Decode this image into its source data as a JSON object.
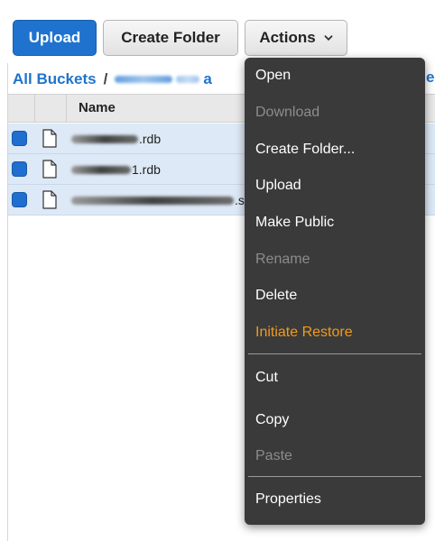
{
  "toolbar": {
    "upload_label": "Upload",
    "create_folder_label": "Create Folder",
    "actions_label": "Actions"
  },
  "breadcrumb": {
    "root": "All Buckets",
    "separator": "/",
    "current_suffix": "a",
    "trailing_fragment": "er"
  },
  "table": {
    "name_header": "Name",
    "files": [
      {
        "name_visible": ".rdb",
        "selected": true
      },
      {
        "name_visible": "1.rdb",
        "selected": true
      },
      {
        "name_visible": ".s",
        "selected": true
      }
    ]
  },
  "actions_menu": {
    "items": [
      {
        "label": "Open",
        "state": "enabled"
      },
      {
        "label": "Download",
        "state": "disabled"
      },
      {
        "label": "Create Folder...",
        "state": "enabled"
      },
      {
        "label": "Upload",
        "state": "enabled"
      },
      {
        "label": "Make Public",
        "state": "enabled"
      },
      {
        "label": "Rename",
        "state": "disabled"
      },
      {
        "label": "Delete",
        "state": "enabled"
      },
      {
        "label": "Initiate Restore",
        "state": "highlighted"
      },
      {
        "label": "Cut",
        "state": "enabled"
      },
      {
        "label": "Copy",
        "state": "enabled"
      },
      {
        "label": "Paste",
        "state": "disabled"
      },
      {
        "label": "Properties",
        "state": "enabled"
      }
    ]
  },
  "icons": {
    "actions_dropdown": "chevron-down-icon",
    "file": "file-icon",
    "checkbox": "checkbox-checked-icon"
  },
  "colors": {
    "primary": "#1f73cf",
    "menu_bg": "#3a3a3a",
    "menu_accent": "#f29b1b",
    "selected_row": "#dde9f6"
  }
}
